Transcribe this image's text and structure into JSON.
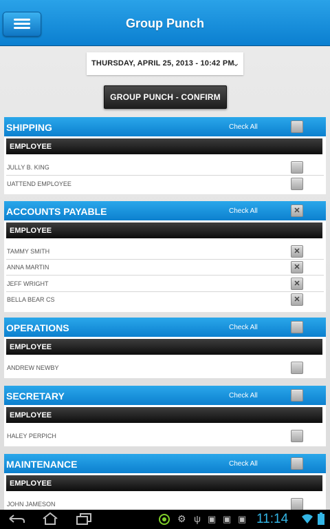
{
  "app": {
    "title": "Group Punch"
  },
  "date_picker": {
    "value": "THURSDAY, APRIL 25, 2013 - 10:42 PM"
  },
  "confirm_button": {
    "label": "GROUP PUNCH - CONFIRM"
  },
  "check_all_label": "Check All",
  "employee_header": "EMPLOYEE",
  "sections": [
    {
      "title": "SHIPPING",
      "check_all": false,
      "employees": [
        {
          "name": "JULLY B. KING",
          "checked": false
        },
        {
          "name": "UATTEND EMPLOYEE",
          "checked": false
        }
      ]
    },
    {
      "title": "ACCOUNTS PAYABLE",
      "check_all": true,
      "employees": [
        {
          "name": "TAMMY SMITH",
          "checked": true
        },
        {
          "name": "ANNA MARTIN",
          "checked": true
        },
        {
          "name": "JEFF WRIGHT",
          "checked": true
        },
        {
          "name": "BELLA BEAR CS",
          "checked": true
        }
      ]
    },
    {
      "title": "OPERATIONS",
      "check_all": false,
      "employees": [
        {
          "name": "ANDREW NEWBY",
          "checked": false
        }
      ]
    },
    {
      "title": "SECRETARY",
      "check_all": false,
      "employees": [
        {
          "name": "HALEY PERPICH",
          "checked": false
        }
      ]
    },
    {
      "title": "MAINTENANCE",
      "check_all": false,
      "employees": [
        {
          "name": "JOHN JAMESON",
          "checked": false
        }
      ]
    }
  ],
  "system_bar": {
    "time": "11:14"
  },
  "colors": {
    "accent_blue": "#1a96e0",
    "clock_blue": "#33b5e5",
    "employee_bar": "#1e1e1e"
  },
  "icons": {
    "menu": "hamburger-icon",
    "back": "back-icon",
    "home": "home-icon",
    "recent": "recent-apps-icon",
    "dropdown": "chevron-down-icon"
  }
}
